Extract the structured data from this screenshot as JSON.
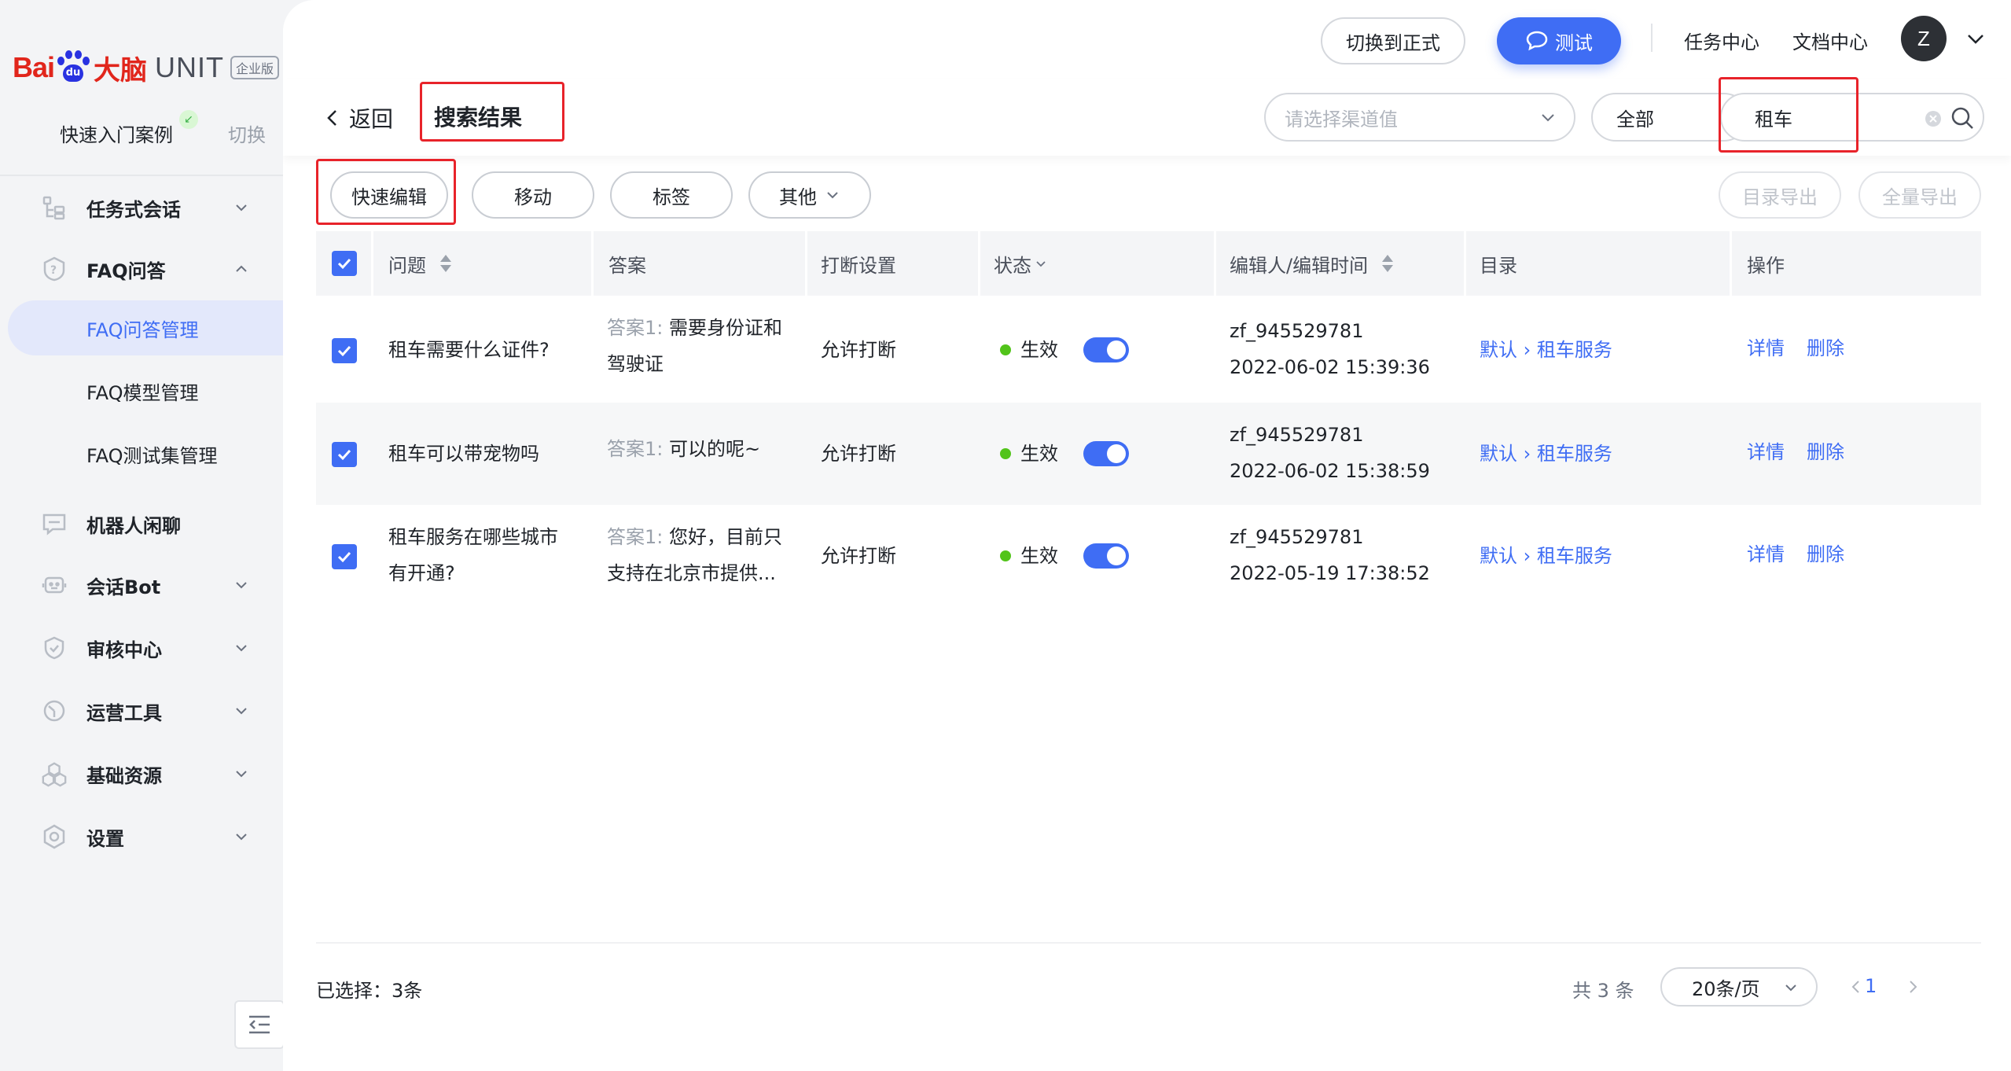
{
  "brand": {
    "logo_left": "Bai",
    "logo_paw_text": "du",
    "logo_cn": "大脑",
    "logo_unit": "UNIT",
    "edition": "企业版"
  },
  "project": {
    "name": "快速入门案例",
    "switch_label": "切换"
  },
  "sidebar": {
    "items": [
      {
        "label": "任务式会话",
        "icon": "task-dialog-icon",
        "expandable": true,
        "expanded": false
      },
      {
        "label": "FAQ问答",
        "icon": "faq-icon",
        "expandable": true,
        "expanded": true,
        "children": [
          {
            "label": "FAQ问答管理",
            "active": true
          },
          {
            "label": "FAQ模型管理"
          },
          {
            "label": "FAQ测试集管理"
          }
        ]
      },
      {
        "label": "机器人闲聊",
        "icon": "chat-icon",
        "expandable": false
      },
      {
        "label": "会话Bot",
        "icon": "bot-icon",
        "expandable": true,
        "expanded": false
      },
      {
        "label": "审核中心",
        "icon": "shield-icon",
        "expandable": true,
        "expanded": false
      },
      {
        "label": "运营工具",
        "icon": "clock-icon",
        "expandable": true,
        "expanded": false
      },
      {
        "label": "基础资源",
        "icon": "cubes-icon",
        "expandable": true,
        "expanded": false
      },
      {
        "label": "设置",
        "icon": "settings-icon",
        "expandable": true,
        "expanded": false
      }
    ]
  },
  "topbar": {
    "switch_formal": "切换到正式",
    "test": "测试",
    "task_center": "任务中心",
    "doc_center": "文档中心",
    "avatar_letter": "Z"
  },
  "header": {
    "back": "返回",
    "title": "搜索结果",
    "channel_placeholder": "请选择渠道值",
    "scope": "全部",
    "search_value": "租车"
  },
  "toolbar": {
    "quick_edit": "快速编辑",
    "move": "移动",
    "tag": "标签",
    "other": "其他",
    "export_dir": "目录导出",
    "export_all": "全量导出"
  },
  "table": {
    "columns": {
      "question": "问题",
      "answer": "答案",
      "interrupt": "打断设置",
      "status": "状态",
      "editor": "编辑人/编辑时间",
      "directory": "目录",
      "actions": "操作"
    },
    "answer_prefix": "答案1:",
    "detail_label": "详情",
    "delete_label": "删除",
    "rows": [
      {
        "question_l1": "租车需要什么证件?",
        "question_l2": "",
        "answer_l1": "需要身份证和",
        "answer_l2": "驾驶证",
        "interrupt": "允许打断",
        "status": "生效",
        "enabled": true,
        "editor": "zf_945529781",
        "time": "2022-06-02 15:39:36",
        "dir_root": "默认",
        "dir_leaf": "租车服务",
        "checked": true
      },
      {
        "question_l1": "租车可以带宠物吗",
        "question_l2": "",
        "answer_l1": "可以的呢~",
        "answer_l2": "",
        "interrupt": "允许打断",
        "status": "生效",
        "enabled": true,
        "editor": "zf_945529781",
        "time": "2022-06-02 15:38:59",
        "dir_root": "默认",
        "dir_leaf": "租车服务",
        "checked": true
      },
      {
        "question_l1": "租车服务在哪些城市",
        "question_l2": "有开通?",
        "answer_l1": "您好，目前只",
        "answer_l2": "支持在北京市提供...",
        "interrupt": "允许打断",
        "status": "生效",
        "enabled": true,
        "editor": "zf_945529781",
        "time": "2022-05-19 17:38:52",
        "dir_root": "默认",
        "dir_leaf": "租车服务",
        "checked": true
      }
    ]
  },
  "footer": {
    "selected": "已选择：3条",
    "total": "共 3 条",
    "page_size": "20条/页",
    "current_page": "1"
  },
  "colors": {
    "accent": "#3f6df4",
    "highlight_box": "#e8232a",
    "status_dot": "#52c41a"
  }
}
